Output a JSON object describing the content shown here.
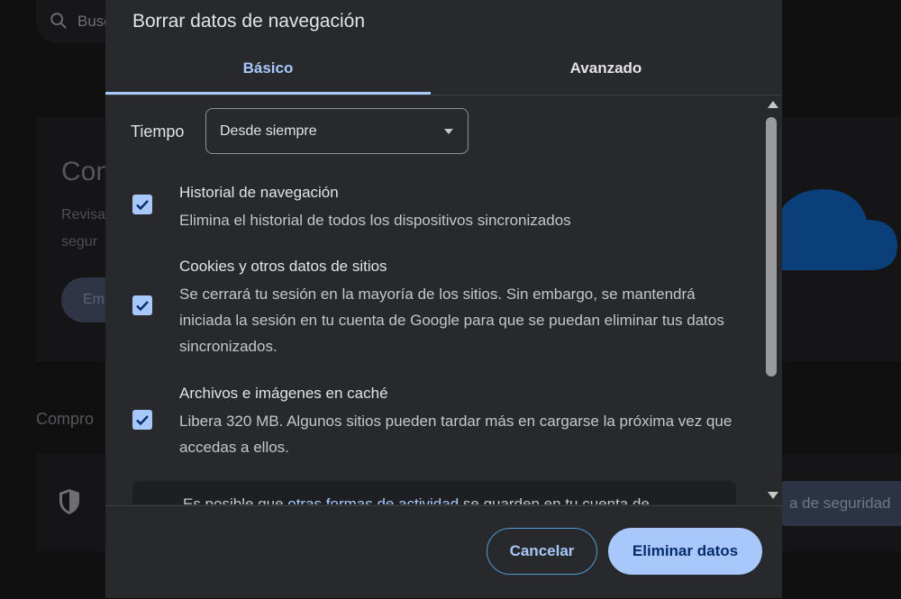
{
  "background": {
    "search_text": "Busc",
    "card_heading": "Con",
    "card_line1": "Revisa",
    "card_line2": "segur",
    "card_button": "Em",
    "section_label": "Compro",
    "pill_text": "a de seguridad"
  },
  "dialog": {
    "title": "Borrar datos de navegación",
    "tabs": [
      {
        "label": "Básico",
        "active": true
      },
      {
        "label": "Avanzado",
        "active": false
      }
    ],
    "time_label": "Tiempo",
    "time_value": "Desde siempre",
    "items": [
      {
        "title": "Historial de navegación",
        "desc": "Elimina el historial de todos los dispositivos sincronizados",
        "checked": true
      },
      {
        "title": "Cookies y otros datos de sitios",
        "desc": "Se cerrará tu sesión en la mayoría de los sitios. Sin embargo, se mantendrá iniciada la sesión en tu cuenta de Google para que se puedan eliminar tus datos sincronizados.",
        "checked": true
      },
      {
        "title": "Archivos e imágenes en caché",
        "desc": "Libera 320 MB. Algunos sitios pueden tardar más en cargarse la próxima vez que accedas a ellos.",
        "checked": true
      }
    ],
    "notice": {
      "prefix": "Es posible que ",
      "link": "otras formas de actividad",
      "suffix": " se guarden en tu cuenta de"
    },
    "cancel_label": "Cancelar",
    "delete_label": "Eliminar datos"
  },
  "colors": {
    "accent": "#a8c7fa",
    "dialog_bg": "#28292c",
    "primary_button_text": "#062e6f"
  }
}
